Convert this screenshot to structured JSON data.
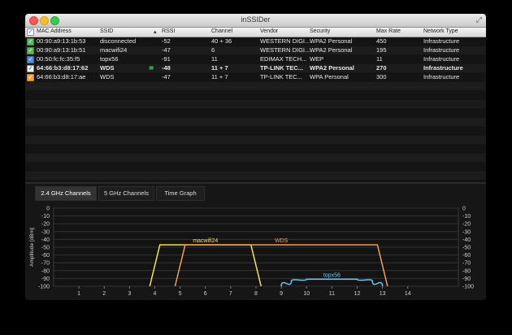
{
  "window": {
    "title": "inSSIDer"
  },
  "table": {
    "columns": [
      "MAC Address",
      "SSID",
      "RSSI",
      "Channel",
      "Vendor",
      "Security",
      "Max Rate",
      "Network Type"
    ],
    "rows": [
      {
        "color": "green",
        "mac": "00:90:a9:13:1b:53",
        "ssid": "disconnected",
        "signal": "",
        "rssi": "-52",
        "channel": "40 + 36",
        "vendor": "WESTERN DIGI...",
        "security": "WPA2 Personal",
        "max_rate": "450",
        "network_type": "Infrastructure",
        "bold": false
      },
      {
        "color": "green",
        "mac": "00:90:a9:13:1b:51",
        "ssid": "macwifi24",
        "signal": "",
        "rssi": "-47",
        "channel": "6",
        "vendor": "WESTERN DIGI...",
        "security": "WPA2 Personal",
        "max_rate": "195",
        "network_type": "Infrastructure",
        "bold": false
      },
      {
        "color": "blue",
        "mac": "00:50:fc:fc:35:f5",
        "ssid": "topx56",
        "signal": "",
        "rssi": "-91",
        "channel": "11",
        "vendor": "EDIMAX TECH...",
        "security": "WEP",
        "max_rate": "11",
        "network_type": "Infrastructure",
        "bold": false
      },
      {
        "color": "white",
        "mac": "64:66:b3:d8:17:62",
        "ssid": "WDS",
        "signal": "wifi",
        "rssi": "-48",
        "channel": "11 + 7",
        "vendor": "TP-LINK TEC...",
        "security": "WPA2 Personal",
        "max_rate": "270",
        "network_type": "Infrastructure",
        "bold": true
      },
      {
        "color": "orange",
        "mac": "64:66:b3:d8:17:ae",
        "ssid": "WDS",
        "signal": "",
        "rssi": "-47",
        "channel": "11 + 7",
        "vendor": "TP-LINK TEC...",
        "security": "WPA Personal",
        "max_rate": "300",
        "network_type": "Infrastructure",
        "bold": false
      }
    ]
  },
  "tabs": [
    {
      "label": "2.4 GHz Channels",
      "active": true
    },
    {
      "label": "5 GHz Channels",
      "active": false
    },
    {
      "label": "Time Graph",
      "active": false
    }
  ],
  "chart_data": {
    "type": "line",
    "title": "",
    "ylabel": "Amplitude [dBm]",
    "xlabel": "",
    "x_ticks": [
      1,
      2,
      3,
      4,
      5,
      6,
      7,
      8,
      9,
      10,
      11,
      12,
      13,
      14
    ],
    "y_ticks": [
      0,
      -10,
      -20,
      -30,
      -40,
      -50,
      -60,
      -70,
      -80,
      -90,
      -100
    ],
    "ylim": [
      -100,
      0
    ],
    "xlim": [
      0,
      16
    ],
    "grid": true,
    "series": [
      {
        "name": "macwifi24",
        "color": "#f2e35c",
        "shape": "trapezoid",
        "x": [
          3.8,
          4.2,
          7.8,
          8.2
        ],
        "y": [
          -100,
          -47,
          -47,
          -100
        ]
      },
      {
        "name": "WDS",
        "color": "#f2a05a",
        "shape": "trapezoid",
        "x": [
          4.8,
          5.2,
          12.8,
          13.2
        ],
        "y": [
          -100,
          -47,
          -47,
          -100
        ]
      },
      {
        "name": "topx56",
        "color": "#6fc6ee",
        "shape": "curve",
        "x": [
          9,
          9.4,
          10,
          11,
          12,
          12.6,
          13
        ],
        "y": [
          -100,
          -93,
          -91,
          -91,
          -91,
          -93,
          -100
        ]
      }
    ]
  }
}
